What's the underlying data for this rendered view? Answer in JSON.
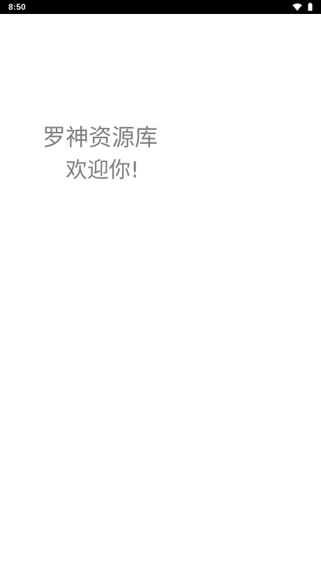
{
  "status_bar": {
    "time": "8:50",
    "icons": [
      "wifi-icon",
      "battery-icon"
    ]
  },
  "splash": {
    "app_name": "罗神资源库",
    "welcome": "欢迎你!"
  },
  "colors": {
    "status_bar_background": "#000000",
    "page_background": "#ffffff",
    "text": "#7f7f7f"
  }
}
